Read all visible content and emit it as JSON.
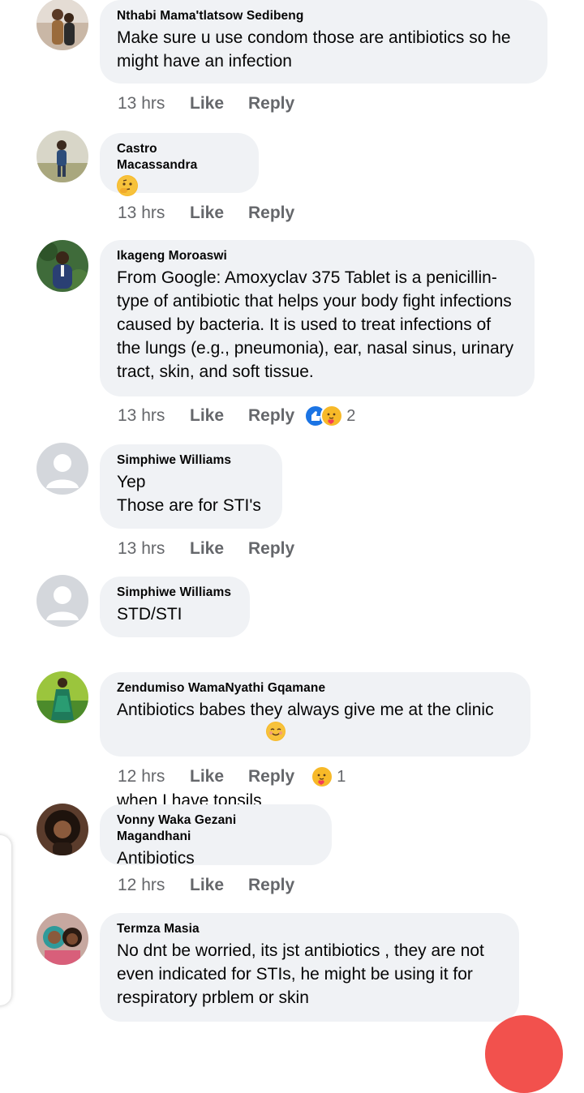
{
  "comments": [
    {
      "author": "Nthabi Mama'tlatsow Sedibeng",
      "text": "Make sure u use condom those are antibiotics so he might have an infection",
      "time": "13 hrs",
      "like": "Like",
      "reply": "Reply"
    },
    {
      "author": "Castro Macassandra",
      "emoji": "thinking-face",
      "time": "13 hrs",
      "like": "Like",
      "reply": "Reply"
    },
    {
      "author": "Ikageng Moroaswi",
      "text": "From Google: Amoxyclav 375 Tablet is a penicillin-type of antibiotic that helps your body fight infections caused by bacteria. It is used to treat infections of the lungs (e.g., pneumonia), ear, nasal sinus, urinary tract, skin, and soft tissue.",
      "time": "13 hrs",
      "like": "Like",
      "reply": "Reply",
      "reactions": {
        "icons": [
          "like",
          "care"
        ],
        "count": "2"
      }
    },
    {
      "author": "Simphiwe Williams",
      "text": "Yep\nThose are for STI's",
      "time": "13 hrs",
      "like": "Like",
      "reply": "Reply"
    },
    {
      "author": "Simphiwe Williams",
      "text": "STD/STI"
    },
    {
      "author": "Zendumiso WamaNyathi Gqamane",
      "text": "Antibiotics babes they always give me at the clinic when I have tonsils",
      "text_emoji": "smiling-face",
      "time": "12 hrs",
      "like": "Like",
      "reply": "Reply",
      "reactions": {
        "icons": [
          "care"
        ],
        "count": "1"
      }
    },
    {
      "author": "Vonny Waka Gezani Magandhani",
      "text": "Antibiotics",
      "time": "12 hrs",
      "like": "Like",
      "reply": "Reply"
    },
    {
      "author": "Termza Masia",
      "text": "No dnt be worried, its jst antibiotics , they are not even indicated for STIs, he might be using it for respiratory prblem or skin"
    }
  ],
  "colors": {
    "bubble": "#f0f2f5",
    "meta": "#65676b",
    "like_reaction": "#1b74e4",
    "care_reaction": "#f7b928",
    "fab": "#f2514d"
  }
}
